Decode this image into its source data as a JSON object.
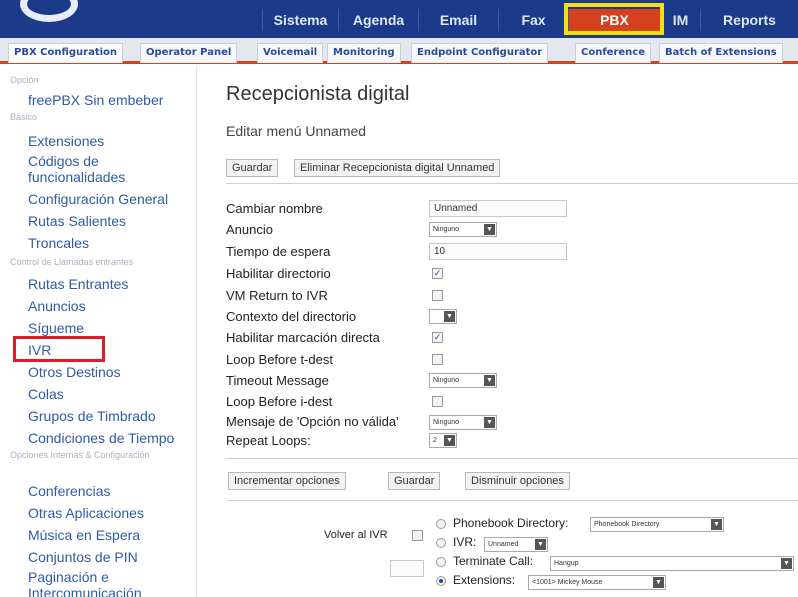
{
  "top_nav": {
    "items": [
      "Sistema",
      "Agenda",
      "Email",
      "Fax",
      "PBX",
      "IM",
      "Reports"
    ],
    "active": "PBX"
  },
  "sub_tabs": [
    "PBX Configuration",
    "Operator Panel",
    "Voicemail",
    "Monitoring",
    "Endpoint Configurator",
    "Conference",
    "Batch of Extensions"
  ],
  "sidebar": {
    "categories": [
      "Opción",
      "Básico",
      "Control de Llamadas entrantes",
      "Opciones Internas & Configuración"
    ],
    "items": [
      "freePBX Sin embeber",
      "Extensiones",
      "Códigos de funcionalidades",
      "Configuración General",
      "Rutas Salientes",
      "Troncales",
      "Rutas Entrantes",
      "Anuncios",
      "Sígueme",
      "IVR",
      "Otros Destinos",
      "Colas",
      "Grupos de Timbrado",
      "Condiciones de Tiempo",
      "Conferencias",
      "Otras Aplicaciones",
      "Música en Espera",
      "Conjuntos de PIN",
      "Paginación e Intercomunicación"
    ],
    "selected": "IVR"
  },
  "main": {
    "title": "Recepcionista digital",
    "subtitle": "Editar menú Unnamed",
    "buttons_top": [
      "Guardar",
      "Eliminar Recepcionista digital Unnamed"
    ],
    "form": {
      "rows": [
        {
          "label": "Cambiar nombre",
          "type": "text",
          "value": "Unnamed"
        },
        {
          "label": "Anuncio",
          "type": "select",
          "value": "Ninguno"
        },
        {
          "label": "Tiempo de espera",
          "type": "text",
          "value": "10"
        },
        {
          "label": "Habilitar directorio",
          "type": "checkbox",
          "checked": true
        },
        {
          "label": "VM Return to IVR",
          "type": "checkbox",
          "checked": false
        },
        {
          "label": "Contexto del directorio",
          "type": "select",
          "value": ""
        },
        {
          "label": "Habilitar marcación directa",
          "type": "checkbox",
          "checked": true
        },
        {
          "label": "Loop Before t-dest",
          "type": "checkbox",
          "checked": false
        },
        {
          "label": "Timeout Message",
          "type": "select",
          "value": "Ninguno"
        },
        {
          "label": "Loop Before i-dest",
          "type": "checkbox",
          "checked": false
        },
        {
          "label": "Mensaje de 'Opción no válida'",
          "type": "select",
          "value": "Ninguno"
        },
        {
          "label": "Repeat Loops:",
          "type": "select",
          "value": "2"
        }
      ]
    },
    "buttons_bottom": [
      "Incrementar opciones",
      "Guardar",
      "Disminuir opciones"
    ],
    "option": {
      "return_label": "Volver al IVR",
      "return_checked": false,
      "digit_value": "",
      "destinations": [
        {
          "label": "Phonebook Directory:",
          "value": "Phonebook Directory",
          "selected": false
        },
        {
          "label": "IVR:",
          "value": "Unnamed",
          "selected": false
        },
        {
          "label": "Terminate Call:",
          "value": "Hangup",
          "selected": false
        },
        {
          "label": "Extensions:",
          "value": "<1001> Mickey Mouse",
          "selected": true
        }
      ]
    }
  }
}
